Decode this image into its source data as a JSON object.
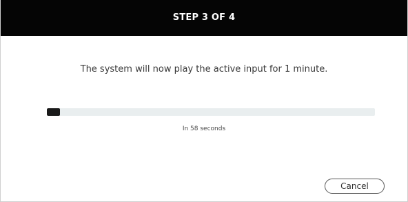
{
  "header": {
    "title": "STEP 3 OF 4"
  },
  "message": "The system will now play the active input for 1 minute.",
  "progress": {
    "fraction": 0.04,
    "caption": "In 58 seconds"
  },
  "actions": {
    "cancel_label": "Cancel"
  },
  "colors": {
    "header_bg": "#050505",
    "progress_track": "#e9eeef",
    "progress_fill": "#1a1a1a"
  }
}
